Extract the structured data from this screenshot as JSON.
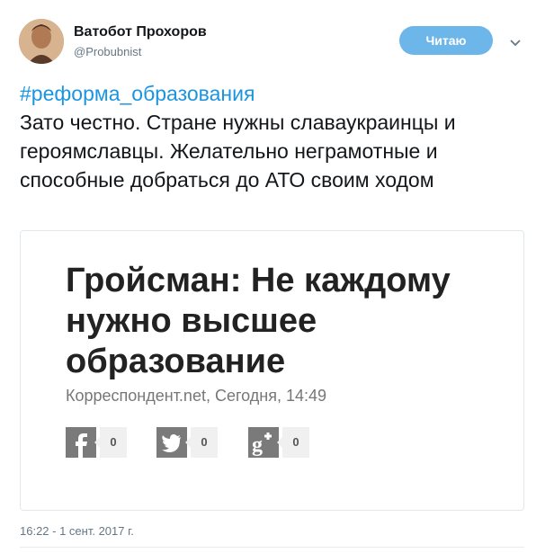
{
  "author": {
    "name": "Ватобот Прохоров",
    "handle": "@Probubnist"
  },
  "follow_button": {
    "label": "Читаю"
  },
  "tweet": {
    "hashtag": "#реформа_образования",
    "text": "Зато честно. Стране нужны славаукраинцы и героямславцы. Желательно неграмотные и способные добраться до АТО своим ходом",
    "timestamp": "16:22 - 1 сент. 2017 г."
  },
  "card": {
    "headline": "Гройсман: Не каждому нужно высшее образование",
    "meta": "Корреспондент.net, Сегодня, 14:49",
    "shares": [
      {
        "icon": "facebook-icon",
        "count": "0"
      },
      {
        "icon": "twitter-icon",
        "count": "0"
      },
      {
        "icon": "google-plus-icon",
        "count": "0"
      }
    ]
  },
  "colors": {
    "accent": "#1b95e0",
    "follow_button": "#6cb6ea",
    "share_icon_bg": "#7a7a7a"
  }
}
